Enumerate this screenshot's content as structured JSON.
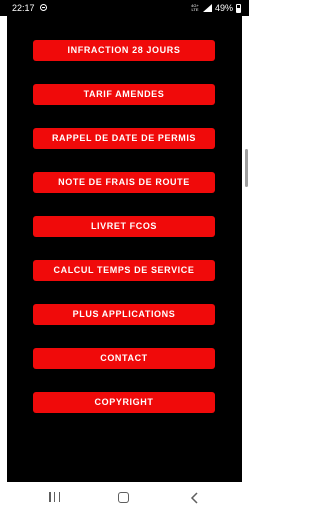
{
  "status_bar": {
    "time": "22:17",
    "network_labels": [
      "4G+",
      "LTE"
    ],
    "battery_text": "49%",
    "battery_level": 0.49
  },
  "menu": {
    "buttons": [
      {
        "label": "INFRACTION 28 JOURS"
      },
      {
        "label": "TARIF AMENDES"
      },
      {
        "label": "RAPPEL DE DATE DE PERMIS"
      },
      {
        "label": "NOTE DE FRAIS DE ROUTE"
      },
      {
        "label": "LIVRET FCOS"
      },
      {
        "label": "CALCUL TEMPS DE SERVICE"
      },
      {
        "label": "PLUS APPLICATIONS"
      },
      {
        "label": "CONTACT"
      },
      {
        "label": "COPYRIGHT"
      }
    ]
  },
  "colors": {
    "button_background": "#f00a0a",
    "app_background": "#000000",
    "button_text": "#ffffff"
  },
  "nav_bar": {
    "icons": [
      "recents-icon",
      "home-icon",
      "back-icon"
    ]
  }
}
